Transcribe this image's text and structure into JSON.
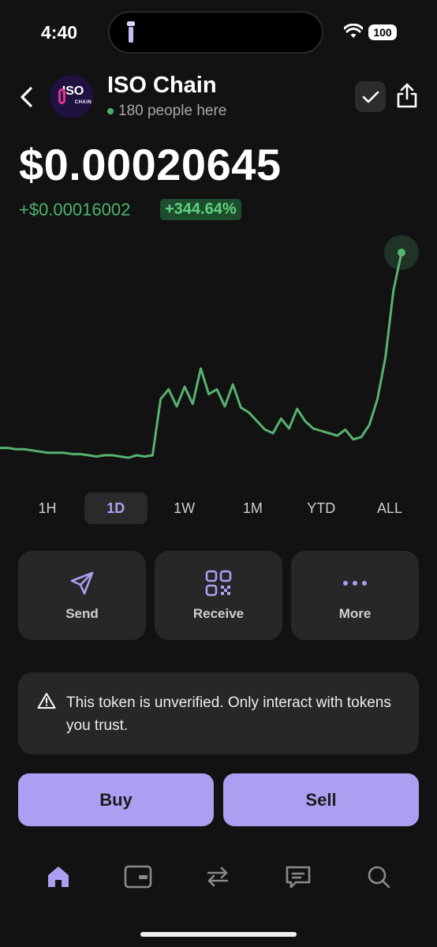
{
  "status": {
    "time": "4:40",
    "battery": "100"
  },
  "token": {
    "name": "ISO Chain",
    "online": "180 people here",
    "logo_text": "ISO",
    "logo_subtext": "CHAIN"
  },
  "price": {
    "current": "$0.00020645",
    "change_abs": "+$0.00016002",
    "change_pct": "+344.64%"
  },
  "chart_data": {
    "type": "line",
    "title": "",
    "series": [
      {
        "values": [
          4.6e-05,
          4.6e-05,
          4.5e-05,
          4.5e-05,
          4.4e-05,
          4.3e-05,
          4.2e-05,
          4.2e-05,
          4.2e-05,
          4.1e-05,
          4.1e-05,
          4e-05,
          3.9e-05,
          4e-05,
          4e-05,
          3.9e-05,
          3.8e-05,
          4e-05,
          3.9e-05,
          4e-05,
          8.6e-05,
          9.4e-05,
          8e-05,
          9.6e-05,
          8.2e-05,
          0.000111,
          9e-05,
          9.4e-05,
          8e-05,
          9.8e-05,
          7.9e-05,
          7.5e-05,
          6.8e-05,
          6.1e-05,
          5.8e-05,
          7e-05,
          6.2e-05,
          7.8e-05,
          6.8e-05,
          6.2e-05,
          6e-05,
          5.8e-05,
          5.6e-05,
          6.1e-05,
          5.3e-05,
          5.5e-05,
          6.5e-05,
          8.6e-05,
          0.00012,
          0.000175,
          0.000206
        ]
      }
    ],
    "colors": {
      "line": "#56b26f",
      "end_marker": "#56b26f"
    }
  },
  "ranges": [
    {
      "label": "1H",
      "active": false
    },
    {
      "label": "1D",
      "active": true
    },
    {
      "label": "1W",
      "active": false
    },
    {
      "label": "1M",
      "active": false
    },
    {
      "label": "YTD",
      "active": false
    },
    {
      "label": "ALL",
      "active": false
    }
  ],
  "actions": {
    "send": "Send",
    "receive": "Receive",
    "more": "More"
  },
  "warning": {
    "text": "This token is unverified. Only interact with tokens you trust."
  },
  "trade": {
    "buy": "Buy",
    "sell": "Sell"
  },
  "nav": [
    "home-icon",
    "wallet-card-icon",
    "swap-icon",
    "chat-icon",
    "search-icon"
  ],
  "colors": {
    "background": "#121212",
    "accent": "#ab9ff2",
    "positive": "#4bb36a",
    "card": "#272727"
  }
}
